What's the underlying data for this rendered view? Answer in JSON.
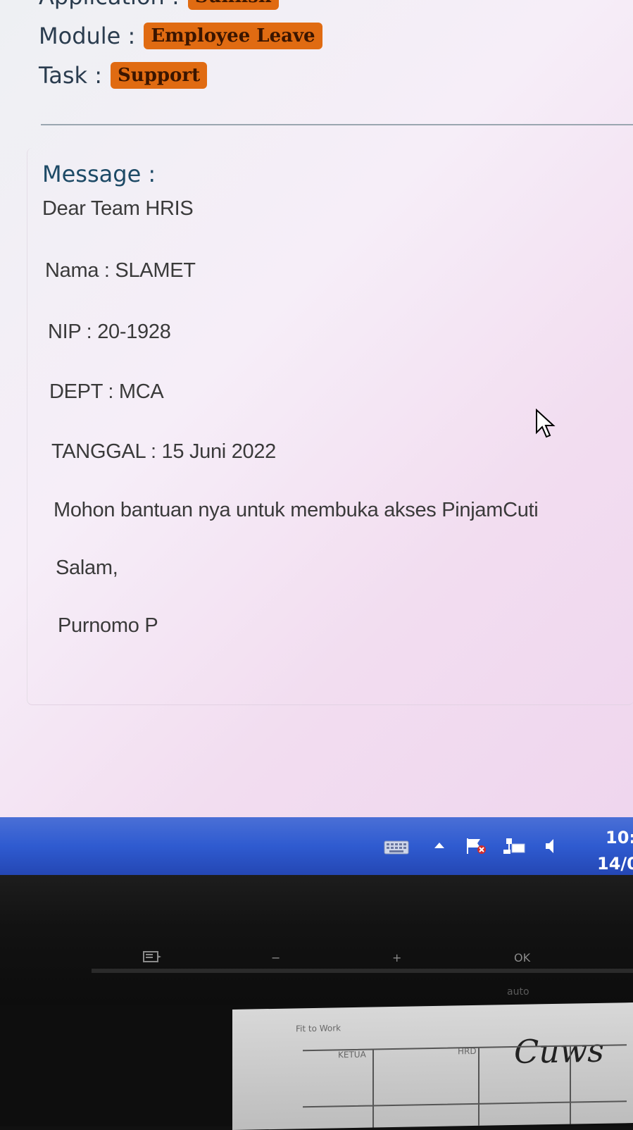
{
  "header": {
    "application_label": "Application :",
    "application_value": "Sunfish",
    "module_label": "Module :",
    "module_value": "Employee Leave",
    "task_label": "Task :",
    "task_value": "Support"
  },
  "message": {
    "title": "Message :",
    "lines": [
      "Dear Team HRIS",
      "Nama : SLAMET",
      "NIP : 20-1928",
      "DEPT : MCA",
      "TANGGAL : 15 Juni 2022",
      "Mohon bantuan nya untuk membuka akses PinjamCuti",
      "Salam,",
      "Purnomo P"
    ]
  },
  "taskbar": {
    "clock_time": "10:",
    "clock_date": "14/0",
    "tray_icons": [
      "keyboard-icon",
      "show-hidden-icons-arrow",
      "action-center-flag-icon",
      "network-icon",
      "volume-icon"
    ],
    "color": "#2f5bd0"
  },
  "bezel": {
    "buttons": [
      "menu-icon",
      "−",
      "+",
      "OK"
    ],
    "auto_label": "auto"
  },
  "paper": {
    "header_text": "Fit to Work",
    "col1": "KETUA",
    "col2": "HRD",
    "handwriting": "Cuws"
  },
  "colors": {
    "badge": "#e06b12",
    "label": "#2b3d4f",
    "message_title": "#1d4a66"
  }
}
